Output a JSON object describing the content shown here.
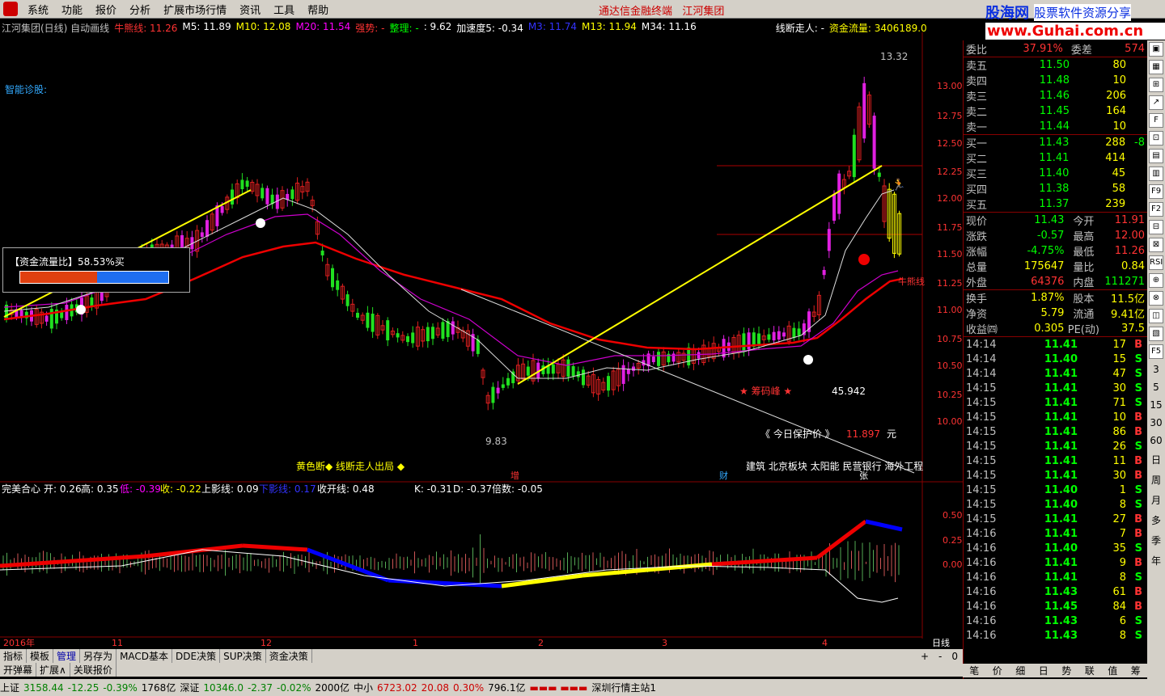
{
  "menubar": {
    "items": [
      "系统",
      "功能",
      "报价",
      "分析",
      "扩展市场行情",
      "资讯",
      "工具",
      "帮助"
    ],
    "center_title": "通达信金融终端",
    "company": "江河集团"
  },
  "logo": {
    "name": "股海网",
    "slogan": "股票软件资源分享",
    "url": "www.Guhai.com.cn"
  },
  "infobar": {
    "stock": "江河集团(日线) 自动画线",
    "niu": "牛熊线: 11.26",
    "m5": "M5: 11.89",
    "m10": "M10: 12.08",
    "m20": "M20: 11.54",
    "qs": "强势: -",
    "zl": "整理: -",
    "val": ": 9.62",
    "jsd": "加速度5: -0.34",
    "m3": "M3: 11.74",
    "m13": "M13: 11.94",
    "m34": "M34: 11.16",
    "xdzr": "线断走人: -",
    "zjll": "资金流量: 3406189.0"
  },
  "chart": {
    "zndg": "智能诊股:",
    "fund_ratio_label": "【资金流量比】58.53%买",
    "high": "13.32",
    "low": "9.83",
    "chouma": "★ 筹码峰 ★",
    "chouma_val": "45.942",
    "protect": "《 今日保护价 》",
    "protect_val": "11.897",
    "yuan": "元",
    "bottom_note": "黄色断◆ 线断走人出局 ◆",
    "sectors": "建筑 北京板块 太阳能 民营银行 海外工程",
    "niu_label": "牛熊线",
    "yticks": [
      "13.00",
      "12.75",
      "12.50",
      "12.25",
      "12.00",
      "11.75",
      "11.50",
      "11.25",
      "11.00",
      "10.75",
      "10.50",
      "10.25",
      "10.00"
    ],
    "markers": [
      "增",
      "财",
      "张"
    ]
  },
  "indicator": {
    "title": "完美合心",
    "kai": "开: 0.26",
    "gao": "高: 0.35",
    "di": "低: -0.39",
    "shou": "收: -0.22",
    "sy": "上影线: 0.09",
    "xy": "下影线: 0.17",
    "skx": "收开线: 0.48",
    "k": "K: -0.31",
    "d": "D: -0.37",
    "bs": "倍数: -0.05",
    "yticks": [
      "0.50",
      "0.25",
      "0.00"
    ]
  },
  "xaxis": {
    "labels": [
      "2016年",
      "11",
      "12",
      "1",
      "2",
      "3",
      "4"
    ],
    "period": "日线"
  },
  "bottom_tabs": [
    "指标",
    "模板",
    "管理",
    "另存为",
    "MACD基本",
    "DDE决策",
    "SUP决策",
    "资金决策"
  ],
  "bottom_tabs2": [
    "开弹幕",
    "扩展∧",
    "关联报价"
  ],
  "panel": {
    "wb": {
      "label": "委比",
      "val": "37.91%",
      "l2": "委差",
      "v2": "574"
    },
    "sells": [
      {
        "n": "卖五",
        "p": "11.50",
        "v": "80"
      },
      {
        "n": "卖四",
        "p": "11.48",
        "v": "10"
      },
      {
        "n": "卖三",
        "p": "11.46",
        "v": "206"
      },
      {
        "n": "卖二",
        "p": "11.45",
        "v": "164"
      },
      {
        "n": "卖一",
        "p": "11.44",
        "v": "10"
      }
    ],
    "buys": [
      {
        "n": "买一",
        "p": "11.43",
        "v": "288",
        "c": "-8"
      },
      {
        "n": "买二",
        "p": "11.41",
        "v": "414",
        "c": ""
      },
      {
        "n": "买三",
        "p": "11.40",
        "v": "45",
        "c": ""
      },
      {
        "n": "买四",
        "p": "11.38",
        "v": "58",
        "c": ""
      },
      {
        "n": "买五",
        "p": "11.37",
        "v": "239",
        "c": ""
      }
    ],
    "stats": [
      {
        "a": "现价",
        "b": "11.43",
        "c": "今开",
        "d": "11.91"
      },
      {
        "a": "涨跌",
        "b": "-0.57",
        "c": "最高",
        "d": "12.00"
      },
      {
        "a": "涨幅",
        "b": "-4.75%",
        "c": "最低",
        "d": "11.26"
      },
      {
        "a": "总量",
        "b": "175647",
        "c": "量比",
        "d": "0.84"
      },
      {
        "a": "外盘",
        "b": "64376",
        "c": "内盘",
        "d": "111271"
      }
    ],
    "stats2": [
      {
        "a": "换手",
        "b": "1.87%",
        "c": "股本",
        "d": "11.5亿"
      },
      {
        "a": "净资",
        "b": "5.79",
        "c": "流通",
        "d": "9.41亿"
      },
      {
        "a": "收益㈣",
        "b": "0.305",
        "c": "PE(动)",
        "d": "37.5"
      }
    ],
    "ticks": [
      [
        "14:14",
        "11.41",
        "17",
        "B"
      ],
      [
        "14:14",
        "11.40",
        "15",
        "S"
      ],
      [
        "14:14",
        "11.41",
        "47",
        "S"
      ],
      [
        "14:15",
        "11.41",
        "30",
        "S"
      ],
      [
        "14:15",
        "11.41",
        "71",
        "S"
      ],
      [
        "14:15",
        "11.41",
        "10",
        "B"
      ],
      [
        "14:15",
        "11.41",
        "86",
        "B"
      ],
      [
        "14:15",
        "11.41",
        "26",
        "S"
      ],
      [
        "14:15",
        "11.41",
        "11",
        "B"
      ],
      [
        "14:15",
        "11.41",
        "30",
        "B"
      ],
      [
        "14:15",
        "11.40",
        "1",
        "S"
      ],
      [
        "14:15",
        "11.40",
        "8",
        "S"
      ],
      [
        "14:15",
        "11.41",
        "27",
        "B"
      ],
      [
        "14:16",
        "11.41",
        "7",
        "B"
      ],
      [
        "14:16",
        "11.40",
        "35",
        "S"
      ],
      [
        "14:16",
        "11.41",
        "9",
        "B"
      ],
      [
        "14:16",
        "11.41",
        "8",
        "S"
      ],
      [
        "14:16",
        "11.43",
        "61",
        "B"
      ],
      [
        "14:16",
        "11.45",
        "84",
        "B"
      ],
      [
        "14:16",
        "11.43",
        "6",
        "S"
      ],
      [
        "14:16",
        "11.43",
        "8",
        "S"
      ]
    ],
    "tabs": [
      "笔",
      "价",
      "细",
      "日",
      "势",
      "联",
      "值",
      "筹"
    ]
  },
  "rightbar": {
    "chars": [
      "3",
      "5",
      "15",
      "30",
      "60",
      "日",
      "周",
      "月",
      "多",
      "季",
      "年"
    ]
  },
  "status": {
    "sh": "上证",
    "sh_v": "3158.44",
    "sh_c": "-12.25",
    "sh_p": "-0.39%",
    "sh_a": "1768亿",
    "sz": "深证",
    "sz_v": "10346.0",
    "sz_c": "-2.37",
    "sz_p": "-0.02%",
    "sz_a": "2000亿",
    "zx": "中小",
    "zx_v": "6723.02",
    "zx_c": "20.08",
    "zx_p": "0.30%",
    "zx_a": "796.1亿",
    "station": "深圳行情主站1"
  }
}
